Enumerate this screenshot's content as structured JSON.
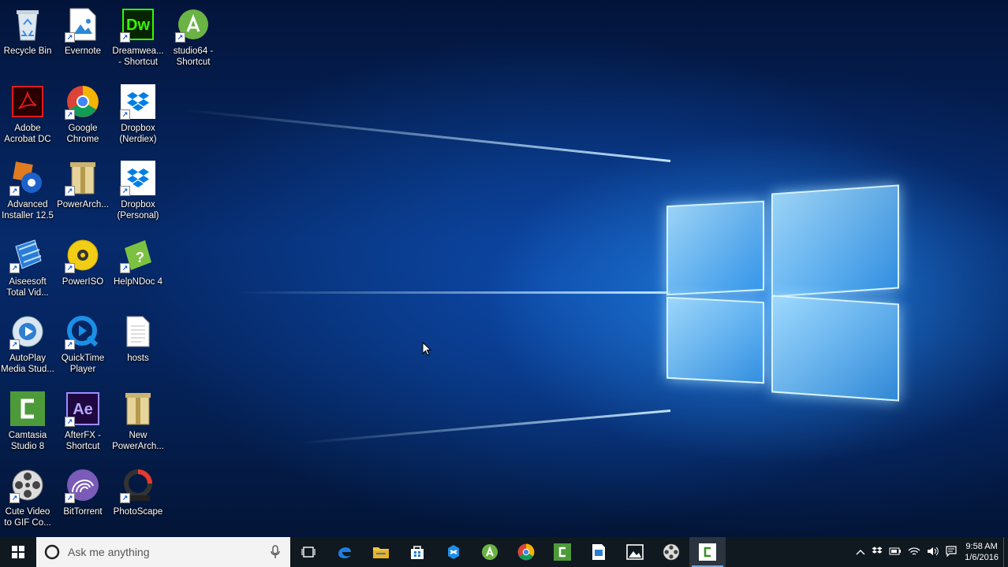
{
  "desktop": {
    "icons": [
      {
        "label": "Recycle Bin",
        "icon": "recycle-bin-icon"
      },
      {
        "label": "Evernote",
        "icon": "evernote-icon"
      },
      {
        "label": "Dreamwea...\n- Shortcut",
        "icon": "dreamweaver-icon",
        "text": "Dw"
      },
      {
        "label": "studio64 -\nShortcut",
        "icon": "android-studio-icon"
      },
      {
        "label": "Adobe\nAcrobat DC",
        "icon": "acrobat-icon"
      },
      {
        "label": "Google\nChrome",
        "icon": "chrome-icon"
      },
      {
        "label": "Dropbox\n(Nerdiex)",
        "icon": "dropbox-icon"
      },
      {
        "label": "Advanced\nInstaller 12.5",
        "icon": "advanced-installer-icon"
      },
      {
        "label": "PowerArch...",
        "icon": "powerarchiver-icon"
      },
      {
        "label": "Dropbox\n(Personal)",
        "icon": "dropbox-icon"
      },
      {
        "label": "Aiseesoft\nTotal Vid...",
        "icon": "aiseesoft-icon"
      },
      {
        "label": "PowerISO",
        "icon": "poweriso-icon"
      },
      {
        "label": "HelpNDoc 4",
        "icon": "helpndoc-icon"
      },
      {
        "label": "AutoPlay\nMedia Stud...",
        "icon": "autoplay-icon"
      },
      {
        "label": "QuickTime\nPlayer",
        "icon": "quicktime-icon"
      },
      {
        "label": "hosts",
        "icon": "text-file-icon"
      },
      {
        "label": "Camtasia\nStudio 8",
        "icon": "camtasia-icon"
      },
      {
        "label": "AfterFX -\nShortcut",
        "icon": "after-effects-icon",
        "text": "Ae"
      },
      {
        "label": "New\nPowerArch...",
        "icon": "zip-archive-icon"
      },
      {
        "label": "Cute Video\nto GIF Co...",
        "icon": "film-reel-icon"
      },
      {
        "label": "BitTorrent",
        "icon": "bittorrent-icon"
      },
      {
        "label": "PhotoScape",
        "icon": "photoscape-icon"
      }
    ]
  },
  "taskbar": {
    "search_placeholder": "Ask me anything",
    "pinned": [
      "edge-icon",
      "file-explorer-icon",
      "store-icon",
      "app-icon",
      "android-studio-icon",
      "chrome-icon",
      "camtasia-icon",
      "notepad-icon",
      "photos-icon",
      "film-reel-icon",
      "camtasia-recorder-icon"
    ],
    "clock_time": "9:58 AM",
    "clock_date": "1/6/2016"
  },
  "colors": {
    "taskbar_bg": "#101820",
    "accent": "#6fa8e8"
  }
}
